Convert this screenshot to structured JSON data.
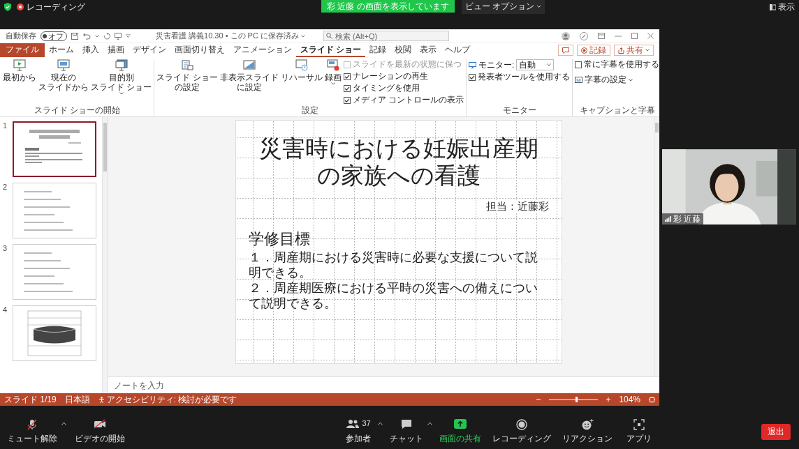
{
  "meeting_bar": {
    "recording_label": "レコーディング",
    "share_banner": "彩 近藤 の画面を表示しています",
    "view_options": "ビュー オプション",
    "view_button": "表示"
  },
  "powerpoint": {
    "title_bar": {
      "autosave": {
        "label": "自動保存",
        "on": false,
        "state_text": "オフ"
      },
      "document_title": "災害看護 講義10.30 • この PC に保存済み",
      "search_placeholder": "検索 (Alt+Q)"
    },
    "tabs": [
      {
        "label": "ファイル",
        "kind": "file",
        "selected": false
      },
      {
        "label": "ホーム",
        "kind": "tab",
        "selected": false
      },
      {
        "label": "挿入",
        "kind": "tab",
        "selected": false
      },
      {
        "label": "描画",
        "kind": "tab",
        "selected": false
      },
      {
        "label": "デザイン",
        "kind": "tab",
        "selected": false
      },
      {
        "label": "画面切り替え",
        "kind": "tab",
        "selected": false
      },
      {
        "label": "アニメーション",
        "kind": "tab",
        "selected": false
      },
      {
        "label": "スライド ショー",
        "kind": "tab",
        "selected": true
      },
      {
        "label": "記録",
        "kind": "tab",
        "selected": false
      },
      {
        "label": "校閲",
        "kind": "tab",
        "selected": false
      },
      {
        "label": "表示",
        "kind": "tab",
        "selected": false
      },
      {
        "label": "ヘルプ",
        "kind": "tab",
        "selected": false
      }
    ],
    "tab_actions": {
      "record": "記録",
      "share": "共有"
    },
    "ribbon_groups": [
      {
        "label": "スライド ショーの開始",
        "items": [
          {
            "kind": "big",
            "lines": [
              "最初から"
            ]
          },
          {
            "kind": "big",
            "lines": [
              "現在の",
              "スライドから"
            ]
          },
          {
            "kind": "big",
            "lines": [
              "目的別",
              "スライド ショー"
            ],
            "dropdown": true
          }
        ]
      },
      {
        "label": "設定",
        "items": [
          {
            "kind": "big",
            "lines": [
              "スライド ショー",
              "の設定"
            ]
          },
          {
            "kind": "big",
            "lines": [
              "非表示スライド",
              "に設定"
            ]
          },
          {
            "kind": "big",
            "lines": [
              "リハーサル"
            ]
          },
          {
            "kind": "big",
            "lines": [
              "録画"
            ],
            "dropdown": true
          },
          {
            "kind": "check",
            "label": "スライドを最新の状態に保つ",
            "checked": false,
            "disabled": true
          },
          {
            "kind": "check",
            "label": "ナレーションの再生",
            "checked": true,
            "disabled": false
          },
          {
            "kind": "check",
            "label": "タイミングを使用",
            "checked": true,
            "disabled": false
          },
          {
            "kind": "check",
            "label": "メディア コントロールの表示",
            "checked": true,
            "disabled": false
          }
        ]
      },
      {
        "label": "モニター",
        "items": [
          {
            "kind": "select",
            "label": "モニター:",
            "value": "自動"
          },
          {
            "kind": "check",
            "label": "発表者ツールを使用する",
            "checked": true,
            "disabled": false
          }
        ]
      },
      {
        "label": "キャプションと字幕",
        "items": [
          {
            "kind": "check",
            "label": "常に字幕を使用する",
            "checked": false,
            "disabled": false
          },
          {
            "kind": "small",
            "label": "字幕の設定",
            "dropdown": true
          }
        ]
      }
    ],
    "slides": [
      {
        "number": "1",
        "kind": "title",
        "selected": true
      },
      {
        "number": "2",
        "kind": "bullets",
        "selected": false
      },
      {
        "number": "3",
        "kind": "bullets",
        "selected": false
      },
      {
        "number": "4",
        "kind": "diagram",
        "selected": false
      }
    ],
    "slide": {
      "title_lines": [
        "災害時における妊娠出産期",
        "の家族への看護"
      ],
      "presenter": "担当：近藤彩",
      "heading": "学修目標",
      "items": [
        "１．周産期における災害時に必要な支援について説明できる。",
        "２．周産期医療における平時の災害への備えについて説明できる。"
      ]
    },
    "notes_placeholder": "ノートを入力",
    "status_bar": {
      "slide_count": "スライド 1/19",
      "language": "日本語",
      "accessibility": "アクセシビリティ: 検討が必要です",
      "zoom_slider": {
        "level": 0.55
      },
      "zoom": "104%"
    }
  },
  "video": {
    "name": "彩 近藤"
  },
  "toolbar": [
    {
      "kind": "mic-off",
      "label": "ミュート解除",
      "caret": true
    },
    {
      "kind": "video-off",
      "label": "ビデオの開始",
      "caret": false
    },
    {
      "kind": "participants",
      "label": "参加者",
      "count": "37",
      "caret": true
    },
    {
      "kind": "chat",
      "label": "チャット",
      "caret": true
    },
    {
      "kind": "share",
      "label": "画面の共有",
      "caret": false
    },
    {
      "kind": "record",
      "label": "レコーディング",
      "caret": false
    },
    {
      "kind": "reaction",
      "label": "リアクション",
      "caret": false
    },
    {
      "kind": "apps",
      "label": "アプリ",
      "caret": false
    }
  ],
  "leave_button": "退出"
}
